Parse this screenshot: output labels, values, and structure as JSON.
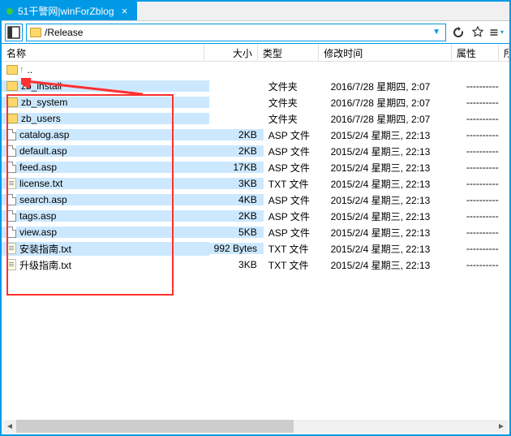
{
  "tab": {
    "title": "51干警网|winForZblog"
  },
  "path": "/Release",
  "columns": {
    "name": "名称",
    "size": "大小",
    "type": "类型",
    "modified": "修改时间",
    "attr": "属性",
    "owner": "所"
  },
  "parent_row": {
    "label": ".."
  },
  "rows": [
    {
      "name": "zb_install",
      "icon": "folder",
      "size": "",
      "type": "文件夹",
      "mod": "2016/7/28 星期四, 2:07",
      "attr": "----------",
      "sel": true
    },
    {
      "name": "zb_system",
      "icon": "folder",
      "size": "",
      "type": "文件夹",
      "mod": "2016/7/28 星期四, 2:07",
      "attr": "----------",
      "sel": true
    },
    {
      "name": "zb_users",
      "icon": "folder",
      "size": "",
      "type": "文件夹",
      "mod": "2016/7/28 星期四, 2:07",
      "attr": "----------",
      "sel": true
    },
    {
      "name": "catalog.asp",
      "icon": "file",
      "size": "2KB",
      "type": "ASP 文件",
      "mod": "2015/2/4 星期三, 22:13",
      "attr": "----------",
      "sel": true
    },
    {
      "name": "default.asp",
      "icon": "file",
      "size": "2KB",
      "type": "ASP 文件",
      "mod": "2015/2/4 星期三, 22:13",
      "attr": "----------",
      "sel": true
    },
    {
      "name": "feed.asp",
      "icon": "file",
      "size": "17KB",
      "type": "ASP 文件",
      "mod": "2015/2/4 星期三, 22:13",
      "attr": "----------",
      "sel": true
    },
    {
      "name": "license.txt",
      "icon": "txt",
      "size": "3KB",
      "type": "TXT 文件",
      "mod": "2015/2/4 星期三, 22:13",
      "attr": "----------",
      "sel": true
    },
    {
      "name": "search.asp",
      "icon": "file",
      "size": "4KB",
      "type": "ASP 文件",
      "mod": "2015/2/4 星期三, 22:13",
      "attr": "----------",
      "sel": true
    },
    {
      "name": "tags.asp",
      "icon": "file",
      "size": "2KB",
      "type": "ASP 文件",
      "mod": "2015/2/4 星期三, 22:13",
      "attr": "----------",
      "sel": true
    },
    {
      "name": "view.asp",
      "icon": "file",
      "size": "5KB",
      "type": "ASP 文件",
      "mod": "2015/2/4 星期三, 22:13",
      "attr": "----------",
      "sel": true
    },
    {
      "name": "安装指南.txt",
      "icon": "txt",
      "size": "992 Bytes",
      "type": "TXT 文件",
      "mod": "2015/2/4 星期三, 22:13",
      "attr": "----------",
      "sel": true
    },
    {
      "name": "升级指南.txt",
      "icon": "txt",
      "size": "3KB",
      "type": "TXT 文件",
      "mod": "2015/2/4 星期三, 22:13",
      "attr": "----------",
      "sel": false
    }
  ]
}
